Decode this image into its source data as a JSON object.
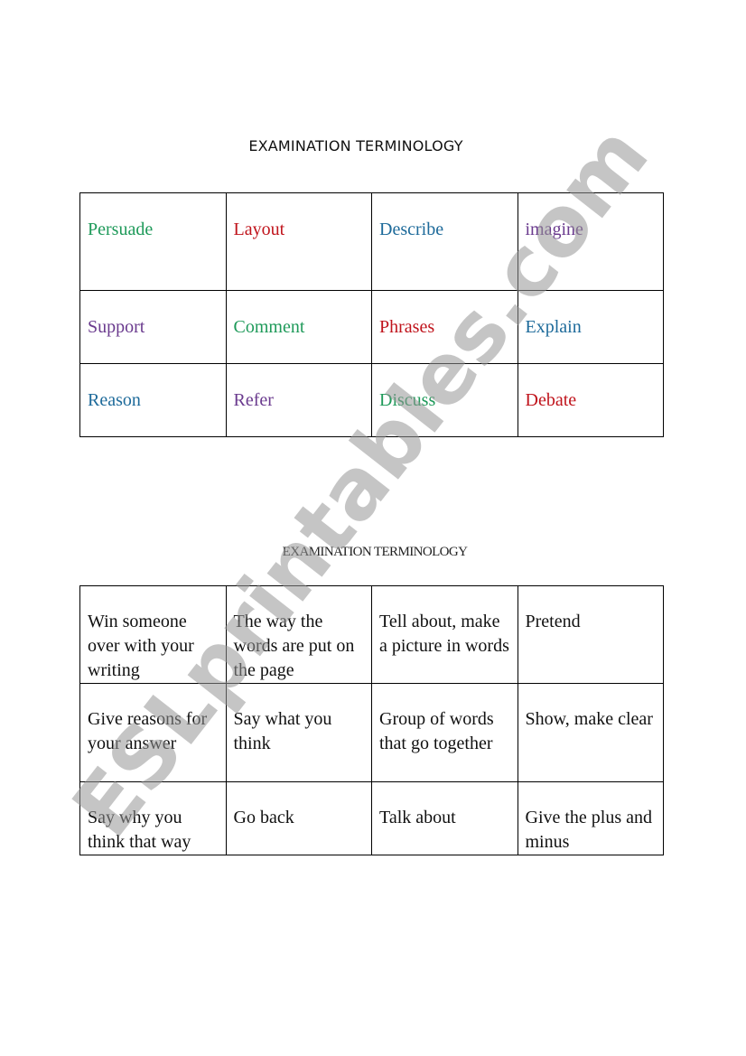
{
  "section1": {
    "title": "EXAMINATION TERMINOLOGY",
    "rows": [
      [
        {
          "text": "Persuade",
          "color": "#1f9a5a"
        },
        {
          "text": "Layout",
          "color": "#c0141c"
        },
        {
          "text": "Describe",
          "color": "#1d6a9a"
        },
        {
          "text": "imagine",
          "color": "#6a3a8e"
        }
      ],
      [
        {
          "text": "Support",
          "color": "#6a3a8e"
        },
        {
          "text": "Comment",
          "color": "#1f9a5a"
        },
        {
          "text": "Phrases",
          "color": "#c0141c"
        },
        {
          "text": "Explain",
          "color": "#1d6a9a"
        }
      ],
      [
        {
          "text": "Reason",
          "color": "#1d6a9a"
        },
        {
          "text": "Refer",
          "color": "#6a3a8e"
        },
        {
          "text": "Discuss",
          "color": "#1f9a5a"
        },
        {
          "text": "Debate",
          "color": "#c0141c"
        }
      ]
    ]
  },
  "section2": {
    "title": "EXAMINATION TERMINOLOGY",
    "rows": [
      [
        "Win someone over with your writing",
        "The way the words are put on the page",
        "Tell about, make a picture in words",
        "Pretend"
      ],
      [
        "Give reasons for your answer",
        "Say what you think",
        "Group of words that go together",
        "Show, make clear"
      ],
      [
        "Say why you think that way",
        "Go back",
        "Talk about",
        "Give the plus and minus"
      ]
    ]
  },
  "watermark": "ESLprintables.com"
}
